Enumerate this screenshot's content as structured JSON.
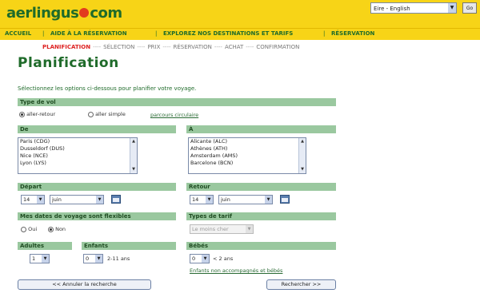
{
  "header": {
    "logo_left": "aerlingus",
    "logo_right": "com",
    "language": "Eire - English",
    "go_label": "Go",
    "nav": [
      "ACCUEIL",
      "AIDE À LA RÉSERVATION",
      "EXPLOREZ NOS DESTINATIONS ET TARIFS",
      "RÉSERVATION"
    ]
  },
  "steps": {
    "active": "PLANIFICATION",
    "others": [
      "SÉLECTION",
      "PRIX",
      "RÉSERVATION",
      "ACHAT",
      "CONFIRMATION"
    ]
  },
  "page_title": "Planification",
  "intro": "Sélectionnez les options ci-dessous pour planifier votre voyage.",
  "trip_type": {
    "header": "Type de vol",
    "options": [
      "aller-retour",
      "aller simple"
    ],
    "selected": 0,
    "link": "parcours circulaire"
  },
  "from": {
    "header": "De",
    "items": [
      "Paris (CDG)",
      "Dusseldorf (DUS)",
      "Nice (NCE)",
      "Lyon (LYS)"
    ]
  },
  "to": {
    "header": "À",
    "items": [
      "Alicante (ALC)",
      "Athènes (ATH)",
      "Amsterdam (AMS)",
      "Barcelone (BCN)"
    ]
  },
  "depart": {
    "header": "Départ",
    "day": "14",
    "month": "juin"
  },
  "return": {
    "header": "Retour",
    "day": "14",
    "month": "juin"
  },
  "flexible": {
    "header": "Mes dates de voyage sont flexibles",
    "options": [
      "Oui",
      "Non"
    ],
    "selected": 1
  },
  "fare_type": {
    "header": "Types de tarif",
    "value": "Le moins cher"
  },
  "passengers": {
    "adults": {
      "header": "Adultes",
      "value": "1"
    },
    "children": {
      "header": "Enfants",
      "value": "0",
      "note": "2-11 ans"
    },
    "infants": {
      "header": "Bébés",
      "value": "0",
      "note": "< 2 ans"
    }
  },
  "unaccompanied_link": "Enfants non accompagnés et bébés",
  "buttons": {
    "back": "<< Annuler la recherche",
    "next": "Rechercher >>"
  }
}
